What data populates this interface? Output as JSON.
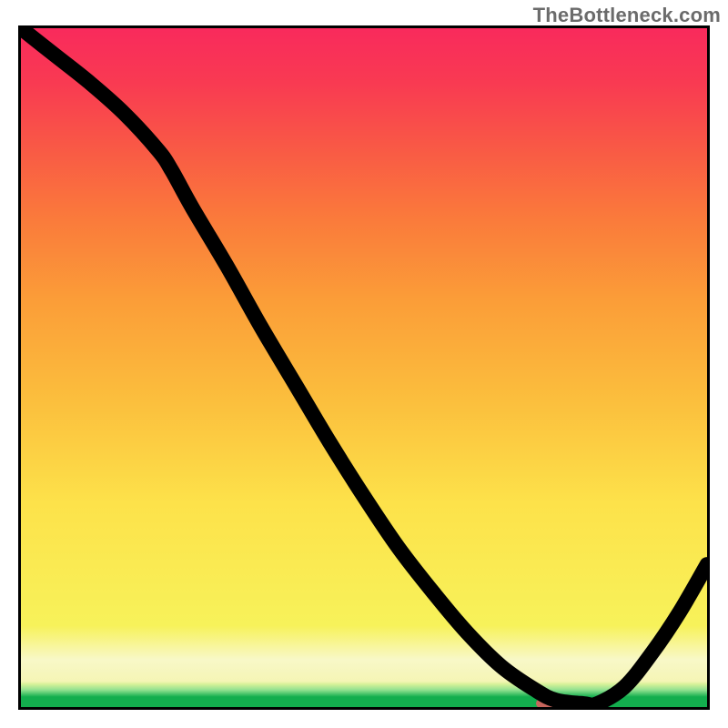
{
  "watermark": "TheBottleneck.com",
  "colors": {
    "border": "#000000",
    "curve": "#000000",
    "marker": "#c8665d",
    "gradient_top": "#f92a5c",
    "gradient_mid": "#fbbf3d",
    "gradient_low": "#f8f8c8",
    "gradient_bottom": "#13ae4e"
  },
  "chart_data": {
    "type": "line",
    "title": "",
    "xlabel": "",
    "ylabel": "",
    "xlim": [
      0,
      100
    ],
    "ylim": [
      0,
      100
    ],
    "x": [
      0,
      5,
      10,
      15,
      20,
      22,
      25,
      30,
      35,
      40,
      45,
      50,
      55,
      60,
      65,
      70,
      75,
      78,
      82,
      84,
      88,
      92,
      96,
      100
    ],
    "values": [
      100,
      96,
      92,
      87.5,
      82,
      79,
      73.5,
      65,
      56,
      47.5,
      39,
      31,
      23.5,
      17,
      11,
      6,
      2.5,
      1,
      0.5,
      0.5,
      3,
      8,
      14,
      21
    ],
    "bottleneck_band": {
      "x_start": 75,
      "x_end": 85,
      "y": 0.6
    },
    "gradient_stops": [
      {
        "pos": 0.0,
        "color": "#13ae4e"
      },
      {
        "pos": 0.025,
        "color": "#8fe08f"
      },
      {
        "pos": 0.038,
        "color": "#f5f5b5"
      },
      {
        "pos": 0.07,
        "color": "#f8f8c8"
      },
      {
        "pos": 0.12,
        "color": "#f7f25a"
      },
      {
        "pos": 0.45,
        "color": "#fbbf3d"
      },
      {
        "pos": 0.72,
        "color": "#fa7a3b"
      },
      {
        "pos": 1.0,
        "color": "#f92a5c"
      }
    ]
  }
}
